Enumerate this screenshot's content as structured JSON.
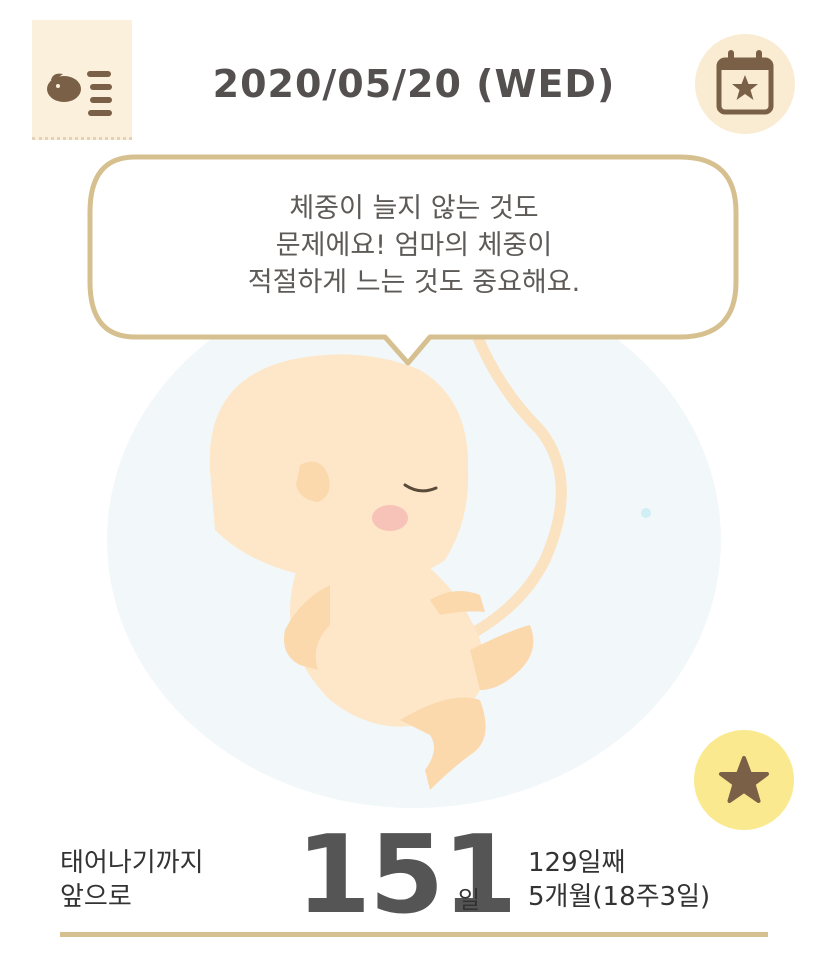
{
  "header": {
    "date": "2020/05/20 (WED)",
    "menu_icon": "baby-list-icon",
    "calendar_icon": "calendar-star-icon"
  },
  "speech": {
    "lines": [
      "체중이 늘지 않는 것도",
      "문제에요! 엄마의 체중이",
      "적절하게 느는 것도 중요해요."
    ]
  },
  "favorite": {
    "icon": "star-icon"
  },
  "countdown": {
    "label_line1": "태어나기까지",
    "label_line2": "앞으로",
    "days_remaining": "151",
    "unit": "일"
  },
  "progress": {
    "day_count": "129일째",
    "months_weeks": "5개월(18주3일)"
  },
  "colors": {
    "accent": "#d6c08f",
    "calendar_bg": "#faecd2",
    "star_bg": "#fae98e",
    "icon_brown": "#7a6046"
  }
}
